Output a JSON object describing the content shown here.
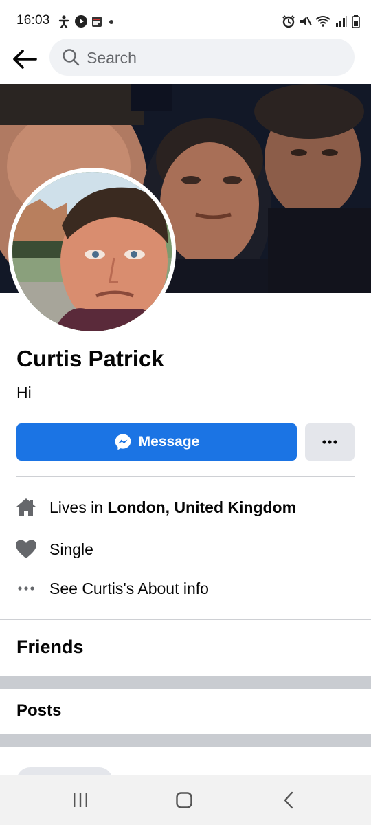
{
  "status_bar": {
    "time": "16:03",
    "left_icons": [
      "accessibility-icon",
      "play-icon",
      "news-app-icon",
      "dot-icon"
    ],
    "right_icons": [
      "alarm-icon",
      "mute-icon",
      "wifi-icon",
      "signal-icon",
      "battery-icon"
    ]
  },
  "search": {
    "placeholder": "Search"
  },
  "profile": {
    "name": "Curtis Patrick",
    "bio": "Hi"
  },
  "actions": {
    "message_label": "Message",
    "more_label": "•••"
  },
  "info": {
    "lives_prefix": "Lives in ",
    "lives_location": "London, United Kingdom",
    "relationship": "Single",
    "about_link": "See Curtis's About info"
  },
  "sections": {
    "friends": "Friends",
    "posts": "Posts"
  },
  "colors": {
    "accent": "#1b74e4",
    "secondary_button": "#e4e6eb",
    "search_bg": "#f0f2f5",
    "icon_gray": "#65676b"
  }
}
